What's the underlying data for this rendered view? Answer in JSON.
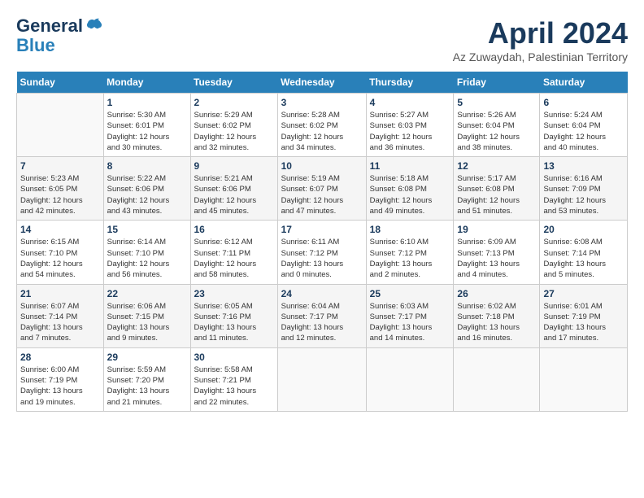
{
  "header": {
    "logo_line1": "General",
    "logo_line2": "Blue",
    "month": "April 2024",
    "location": "Az Zuwaydah, Palestinian Territory"
  },
  "weekdays": [
    "Sunday",
    "Monday",
    "Tuesday",
    "Wednesday",
    "Thursday",
    "Friday",
    "Saturday"
  ],
  "weeks": [
    [
      {
        "day": "",
        "info": ""
      },
      {
        "day": "1",
        "info": "Sunrise: 5:30 AM\nSunset: 6:01 PM\nDaylight: 12 hours\nand 30 minutes."
      },
      {
        "day": "2",
        "info": "Sunrise: 5:29 AM\nSunset: 6:02 PM\nDaylight: 12 hours\nand 32 minutes."
      },
      {
        "day": "3",
        "info": "Sunrise: 5:28 AM\nSunset: 6:02 PM\nDaylight: 12 hours\nand 34 minutes."
      },
      {
        "day": "4",
        "info": "Sunrise: 5:27 AM\nSunset: 6:03 PM\nDaylight: 12 hours\nand 36 minutes."
      },
      {
        "day": "5",
        "info": "Sunrise: 5:26 AM\nSunset: 6:04 PM\nDaylight: 12 hours\nand 38 minutes."
      },
      {
        "day": "6",
        "info": "Sunrise: 5:24 AM\nSunset: 6:04 PM\nDaylight: 12 hours\nand 40 minutes."
      }
    ],
    [
      {
        "day": "7",
        "info": "Sunrise: 5:23 AM\nSunset: 6:05 PM\nDaylight: 12 hours\nand 42 minutes."
      },
      {
        "day": "8",
        "info": "Sunrise: 5:22 AM\nSunset: 6:06 PM\nDaylight: 12 hours\nand 43 minutes."
      },
      {
        "day": "9",
        "info": "Sunrise: 5:21 AM\nSunset: 6:06 PM\nDaylight: 12 hours\nand 45 minutes."
      },
      {
        "day": "10",
        "info": "Sunrise: 5:19 AM\nSunset: 6:07 PM\nDaylight: 12 hours\nand 47 minutes."
      },
      {
        "day": "11",
        "info": "Sunrise: 5:18 AM\nSunset: 6:08 PM\nDaylight: 12 hours\nand 49 minutes."
      },
      {
        "day": "12",
        "info": "Sunrise: 5:17 AM\nSunset: 6:08 PM\nDaylight: 12 hours\nand 51 minutes."
      },
      {
        "day": "13",
        "info": "Sunrise: 6:16 AM\nSunset: 7:09 PM\nDaylight: 12 hours\nand 53 minutes."
      }
    ],
    [
      {
        "day": "14",
        "info": "Sunrise: 6:15 AM\nSunset: 7:10 PM\nDaylight: 12 hours\nand 54 minutes."
      },
      {
        "day": "15",
        "info": "Sunrise: 6:14 AM\nSunset: 7:10 PM\nDaylight: 12 hours\nand 56 minutes."
      },
      {
        "day": "16",
        "info": "Sunrise: 6:12 AM\nSunset: 7:11 PM\nDaylight: 12 hours\nand 58 minutes."
      },
      {
        "day": "17",
        "info": "Sunrise: 6:11 AM\nSunset: 7:12 PM\nDaylight: 13 hours\nand 0 minutes."
      },
      {
        "day": "18",
        "info": "Sunrise: 6:10 AM\nSunset: 7:12 PM\nDaylight: 13 hours\nand 2 minutes."
      },
      {
        "day": "19",
        "info": "Sunrise: 6:09 AM\nSunset: 7:13 PM\nDaylight: 13 hours\nand 4 minutes."
      },
      {
        "day": "20",
        "info": "Sunrise: 6:08 AM\nSunset: 7:14 PM\nDaylight: 13 hours\nand 5 minutes."
      }
    ],
    [
      {
        "day": "21",
        "info": "Sunrise: 6:07 AM\nSunset: 7:14 PM\nDaylight: 13 hours\nand 7 minutes."
      },
      {
        "day": "22",
        "info": "Sunrise: 6:06 AM\nSunset: 7:15 PM\nDaylight: 13 hours\nand 9 minutes."
      },
      {
        "day": "23",
        "info": "Sunrise: 6:05 AM\nSunset: 7:16 PM\nDaylight: 13 hours\nand 11 minutes."
      },
      {
        "day": "24",
        "info": "Sunrise: 6:04 AM\nSunset: 7:17 PM\nDaylight: 13 hours\nand 12 minutes."
      },
      {
        "day": "25",
        "info": "Sunrise: 6:03 AM\nSunset: 7:17 PM\nDaylight: 13 hours\nand 14 minutes."
      },
      {
        "day": "26",
        "info": "Sunrise: 6:02 AM\nSunset: 7:18 PM\nDaylight: 13 hours\nand 16 minutes."
      },
      {
        "day": "27",
        "info": "Sunrise: 6:01 AM\nSunset: 7:19 PM\nDaylight: 13 hours\nand 17 minutes."
      }
    ],
    [
      {
        "day": "28",
        "info": "Sunrise: 6:00 AM\nSunset: 7:19 PM\nDaylight: 13 hours\nand 19 minutes."
      },
      {
        "day": "29",
        "info": "Sunrise: 5:59 AM\nSunset: 7:20 PM\nDaylight: 13 hours\nand 21 minutes."
      },
      {
        "day": "30",
        "info": "Sunrise: 5:58 AM\nSunset: 7:21 PM\nDaylight: 13 hours\nand 22 minutes."
      },
      {
        "day": "",
        "info": ""
      },
      {
        "day": "",
        "info": ""
      },
      {
        "day": "",
        "info": ""
      },
      {
        "day": "",
        "info": ""
      }
    ]
  ]
}
